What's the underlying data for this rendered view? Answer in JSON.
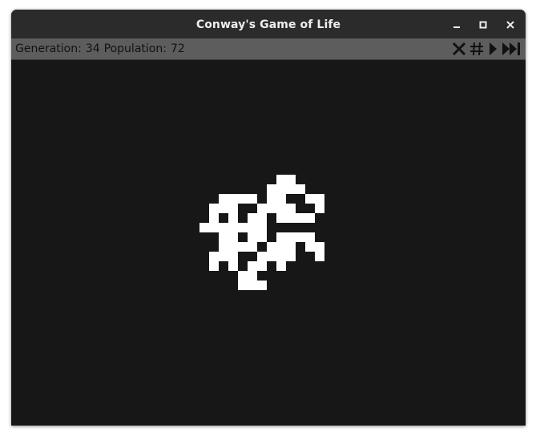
{
  "window": {
    "title": "Conway's Game of Life",
    "controls": [
      "minimize-icon",
      "maximize-icon",
      "close-icon"
    ]
  },
  "status": {
    "generation_label": "Generation:",
    "generation": "34",
    "population_label": "Population:",
    "population": "72"
  },
  "toolbar": {
    "tools": [
      "clear-icon",
      "grid-icon",
      "play-icon",
      "skip-forward-icon"
    ]
  },
  "colors": {
    "background": "#171717",
    "live_cell": "#ffffff",
    "toolbar": "#5d5d5d",
    "titlebar": "#2b2b2b"
  },
  "board": {
    "live_cells": [
      [
        2,
        -6
      ],
      [
        3,
        -6
      ],
      [
        1,
        -5
      ],
      [
        2,
        -5
      ],
      [
        3,
        -5
      ],
      [
        4,
        -5
      ],
      [
        -4,
        -4
      ],
      [
        -3,
        -4
      ],
      [
        -2,
        -4
      ],
      [
        -1,
        -4
      ],
      [
        1,
        -4
      ],
      [
        2,
        -4
      ],
      [
        5,
        -4
      ],
      [
        6,
        -4
      ],
      [
        -5,
        -3
      ],
      [
        -4,
        -3
      ],
      [
        -3,
        -3
      ],
      [
        0,
        -3
      ],
      [
        1,
        -3
      ],
      [
        2,
        -3
      ],
      [
        3,
        -3
      ],
      [
        6,
        -3
      ],
      [
        -5,
        -2
      ],
      [
        -3,
        -2
      ],
      [
        -1,
        -2
      ],
      [
        0,
        -2
      ],
      [
        2,
        -2
      ],
      [
        3,
        -2
      ],
      [
        4,
        -2
      ],
      [
        5,
        -2
      ],
      [
        -6,
        -1
      ],
      [
        -5,
        -1
      ],
      [
        -4,
        -1
      ],
      [
        -3,
        -1
      ],
      [
        -2,
        -1
      ],
      [
        -1,
        -1
      ],
      [
        0,
        -1
      ],
      [
        -4,
        0
      ],
      [
        -3,
        0
      ],
      [
        -1,
        0
      ],
      [
        0,
        0
      ],
      [
        2,
        0
      ],
      [
        3,
        0
      ],
      [
        4,
        0
      ],
      [
        5,
        0
      ],
      [
        3,
        1
      ],
      [
        -4,
        1
      ],
      [
        -3,
        1
      ],
      [
        -2,
        1
      ],
      [
        -1,
        1
      ],
      [
        1,
        1
      ],
      [
        2,
        1
      ],
      [
        5,
        1
      ],
      [
        6,
        1
      ],
      [
        -5,
        2
      ],
      [
        -4,
        2
      ],
      [
        -3,
        2
      ],
      [
        0,
        2
      ],
      [
        1,
        2
      ],
      [
        2,
        2
      ],
      [
        3,
        2
      ],
      [
        6,
        2
      ],
      [
        -5,
        3
      ],
      [
        -3,
        3
      ],
      [
        -1,
        3
      ],
      [
        0,
        3
      ],
      [
        2,
        3
      ],
      [
        -2,
        4
      ],
      [
        -1,
        4
      ],
      [
        -2,
        5
      ],
      [
        -1,
        5
      ],
      [
        0,
        5
      ]
    ]
  }
}
